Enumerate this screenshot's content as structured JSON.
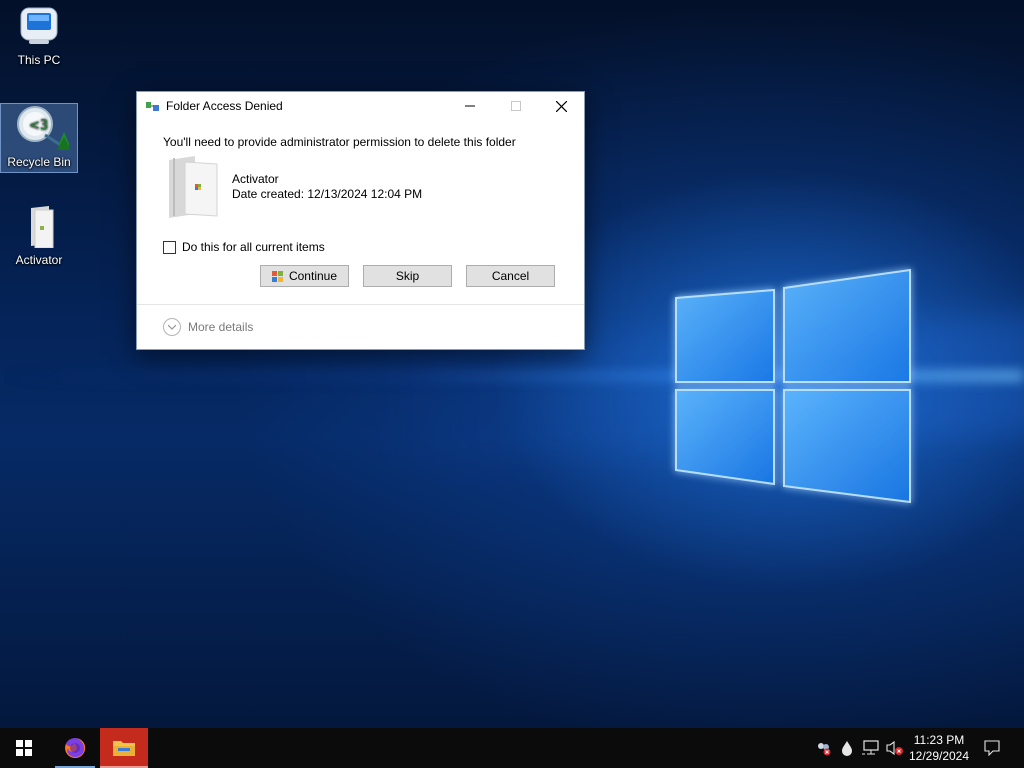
{
  "desktop": {
    "icons": [
      {
        "label": "This PC"
      },
      {
        "label": "Recycle Bin"
      },
      {
        "label": "Activator"
      }
    ]
  },
  "dialog": {
    "title": "Folder Access Denied",
    "message": "You'll need to provide administrator permission to delete this folder",
    "item_name": "Activator",
    "item_date": "Date created: 12/13/2024 12:04 PM",
    "checkbox_label": "Do this for all current items",
    "checkbox_checked": false,
    "buttons": {
      "continue": "Continue",
      "skip": "Skip",
      "cancel": "Cancel"
    },
    "more_details": "More details"
  },
  "taskbar": {
    "apps": [
      {
        "icon": "firefox-icon"
      },
      {
        "icon": "file-explorer-icon"
      }
    ],
    "clock": {
      "time": "11:23 PM",
      "date": "12/29/2024"
    }
  },
  "colors": {
    "explorer_active": "#c42b1c",
    "taskbar": "#0b0b0c"
  }
}
